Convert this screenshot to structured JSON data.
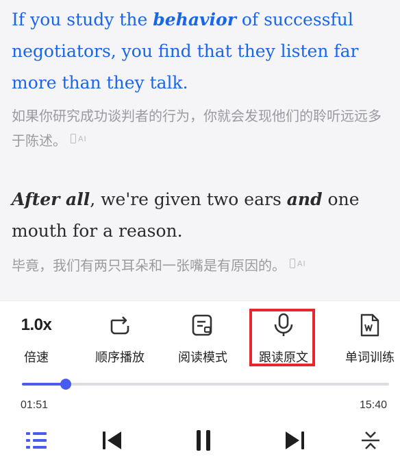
{
  "reader": {
    "para1": {
      "pre": "If you study the ",
      "bold": "behavior",
      "post": " of successful negotiators, you find that they listen far more than they talk.",
      "translation": "如果你研究成功谈判者的行为，你就会发现他们的聆听远远多于陈述。"
    },
    "para2": {
      "bold1": "After all",
      "mid": ", we're given two ears ",
      "bold2": "and",
      "post": " one mouth for a reason.",
      "translation": "毕竟，我们有两只耳朵和一张嘴是有原因的。"
    },
    "ai_badge": "AI"
  },
  "toolbar": {
    "speed_value": "1.0x",
    "speed_label": "倍速",
    "order_label": "顺序播放",
    "reading_mode_label": "阅读模式",
    "follow_read_label": "跟读原文",
    "word_training_label": "单词训练"
  },
  "player": {
    "current_time": "01:51",
    "total_time": "15:40",
    "progress": 0.12
  },
  "colors": {
    "accent": "#4a5cf0",
    "highlight_text": "#1a66e6",
    "highlight_box": "#e8262e"
  }
}
